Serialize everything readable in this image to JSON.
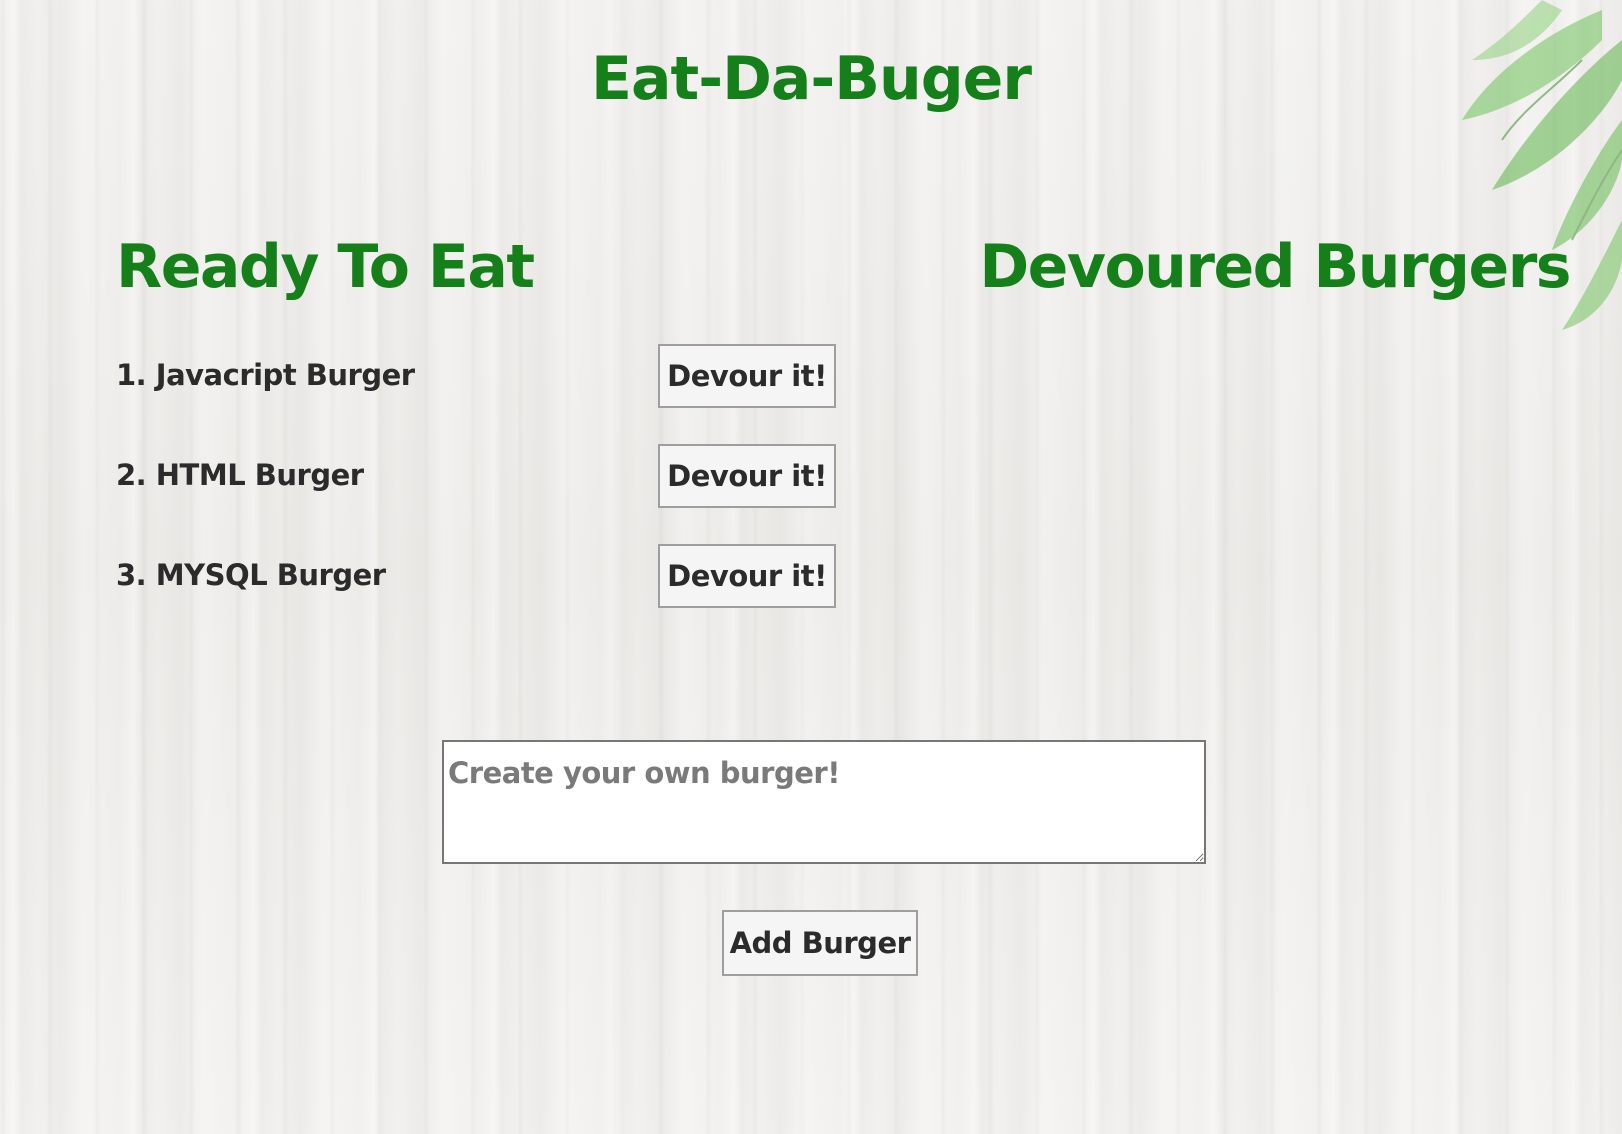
{
  "header": {
    "title": "Eat-Da-Buger"
  },
  "ready": {
    "heading": "Ready To Eat",
    "items": [
      {
        "label": "1. Javacript Burger",
        "button": "Devour it!"
      },
      {
        "label": "2. HTML Burger",
        "button": "Devour it!"
      },
      {
        "label": "3. MYSQL Burger",
        "button": "Devour it!"
      }
    ]
  },
  "devoured": {
    "heading": "Devoured Burgers",
    "items": []
  },
  "form": {
    "placeholder": "Create your own burger!",
    "value": "",
    "submit_label": "Add Burger"
  },
  "colors": {
    "heading_green": "#15801a",
    "text_dark": "#2b2b2b",
    "button_bg": "#f5f5f5"
  },
  "decor": {
    "background": "white-wood-texture",
    "corner_image": "green-leaves"
  }
}
